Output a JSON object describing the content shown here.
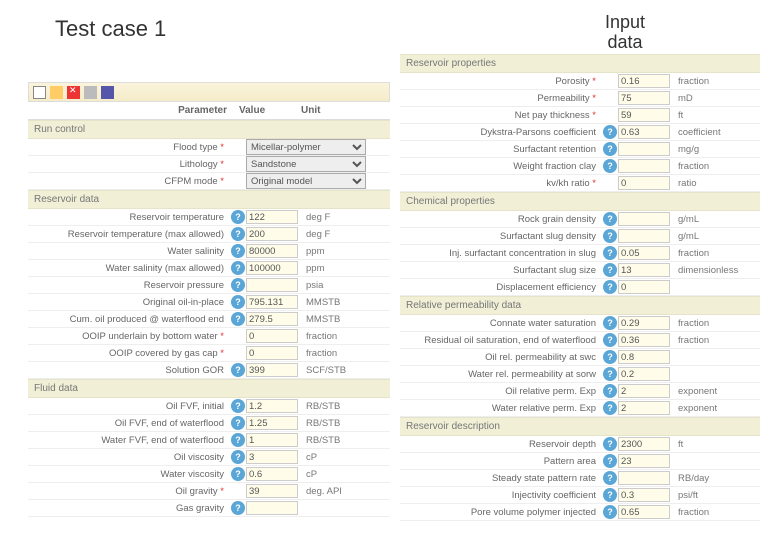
{
  "titles": {
    "left": "Test case 1",
    "right_l1": "Input",
    "right_l2": "data"
  },
  "columns": {
    "parameter": "Parameter",
    "value": "Value",
    "unit": "Unit"
  },
  "toolbar": {
    "new": "new-icon",
    "open": "open-icon",
    "delete": "delete-icon",
    "save": "save-icon"
  },
  "sections_left": [
    {
      "title": "Run control",
      "rows": [
        {
          "label": "Flood type",
          "req": true,
          "help": false,
          "value_select": "Micellar-polymer",
          "unit": ""
        },
        {
          "label": "Lithology",
          "req": true,
          "help": false,
          "value_select": "Sandstone",
          "unit": ""
        },
        {
          "label": "CFPM mode",
          "req": true,
          "help": false,
          "value_select": "Original model",
          "unit": ""
        }
      ]
    },
    {
      "title": "Reservoir data",
      "rows": [
        {
          "label": "Reservoir temperature",
          "req": false,
          "help": true,
          "value": "122",
          "unit": "deg F"
        },
        {
          "label": "Reservoir temperature (max allowed)",
          "req": false,
          "help": true,
          "value": "200",
          "unit": "deg F"
        },
        {
          "label": "Water salinity",
          "req": false,
          "help": true,
          "value": "80000",
          "unit": "ppm"
        },
        {
          "label": "Water salinity (max allowed)",
          "req": false,
          "help": true,
          "value": "100000",
          "unit": "ppm"
        },
        {
          "label": "Reservoir pressure",
          "req": false,
          "help": true,
          "value": "",
          "unit": "psia"
        },
        {
          "label": "Original oil-in-place",
          "req": false,
          "help": true,
          "value": "795.131",
          "unit": "MMSTB"
        },
        {
          "label": "Cum. oil produced @ waterflood end",
          "req": false,
          "help": true,
          "value": "279.5",
          "unit": "MMSTB"
        },
        {
          "label": "OOIP underlain by bottom water",
          "req": true,
          "help": false,
          "value": "0",
          "unit": "fraction"
        },
        {
          "label": "OOIP covered by gas cap",
          "req": true,
          "help": false,
          "value": "0",
          "unit": "fraction"
        },
        {
          "label": "Solution GOR",
          "req": false,
          "help": true,
          "value": "399",
          "unit": "SCF/STB"
        }
      ]
    },
    {
      "title": "Fluid data",
      "rows": [
        {
          "label": "Oil FVF, initial",
          "req": false,
          "help": true,
          "value": "1.2",
          "unit": "RB/STB"
        },
        {
          "label": "Oil FVF, end of waterflood",
          "req": false,
          "help": true,
          "value": "1.25",
          "unit": "RB/STB"
        },
        {
          "label": "Water FVF, end of waterflood",
          "req": false,
          "help": true,
          "value": "1",
          "unit": "RB/STB"
        },
        {
          "label": "Oil viscosity",
          "req": false,
          "help": true,
          "value": "3",
          "unit": "cP"
        },
        {
          "label": "Water viscosity",
          "req": false,
          "help": true,
          "value": "0.6",
          "unit": "cP"
        },
        {
          "label": "Oil gravity",
          "req": true,
          "help": false,
          "value": "39",
          "unit": "deg. API"
        },
        {
          "label": "Gas gravity",
          "req": false,
          "help": true,
          "value": "",
          "unit": ""
        }
      ]
    }
  ],
  "sections_right": [
    {
      "title": "Reservoir properties",
      "rows": [
        {
          "label": "Porosity",
          "req": true,
          "help": false,
          "value": "0.16",
          "unit": "fraction"
        },
        {
          "label": "Permeability",
          "req": true,
          "help": false,
          "value": "75",
          "unit": "mD"
        },
        {
          "label": "Net pay thickness",
          "req": true,
          "help": false,
          "value": "59",
          "unit": "ft"
        },
        {
          "label": "Dykstra-Parsons coefficient",
          "req": false,
          "help": true,
          "value": "0.63",
          "unit": "coefficient"
        },
        {
          "label": "Surfactant retention",
          "req": false,
          "help": true,
          "value": "",
          "unit": "mg/g"
        },
        {
          "label": "Weight fraction clay",
          "req": false,
          "help": true,
          "value": "",
          "unit": "fraction"
        },
        {
          "label": "kv/kh ratio",
          "req": true,
          "help": false,
          "value": "0",
          "unit": "ratio"
        }
      ]
    },
    {
      "title": "Chemical properties",
      "rows": [
        {
          "label": "Rock grain density",
          "req": false,
          "help": true,
          "value": "",
          "unit": "g/mL"
        },
        {
          "label": "Surfactant slug density",
          "req": false,
          "help": true,
          "value": "",
          "unit": "g/mL"
        },
        {
          "label": "Inj. surfactant concentration in slug",
          "req": false,
          "help": true,
          "value": "0.05",
          "unit": "fraction"
        },
        {
          "label": "Surfactant slug size",
          "req": false,
          "help": true,
          "value": "13",
          "unit": "dimensionless"
        },
        {
          "label": "Displacement efficiency",
          "req": false,
          "help": true,
          "value": "0",
          "unit": ""
        }
      ]
    },
    {
      "title": "Relative permeability data",
      "rows": [
        {
          "label": "Connate water saturation",
          "req": false,
          "help": true,
          "value": "0.29",
          "unit": "fraction"
        },
        {
          "label": "Residual oil saturation, end of waterflood",
          "req": false,
          "help": true,
          "value": "0.36",
          "unit": "fraction"
        },
        {
          "label": "Oil rel. permeability at swc",
          "req": false,
          "help": true,
          "value": "0.8",
          "unit": ""
        },
        {
          "label": "Water rel. permeability at sorw",
          "req": false,
          "help": true,
          "value": "0.2",
          "unit": ""
        },
        {
          "label": "Oil relative perm. Exp",
          "req": false,
          "help": true,
          "value": "2",
          "unit": "exponent"
        },
        {
          "label": "Water relative perm. Exp",
          "req": false,
          "help": true,
          "value": "2",
          "unit": "exponent"
        }
      ]
    },
    {
      "title": "Reservoir description",
      "rows": [
        {
          "label": "Reservoir depth",
          "req": false,
          "help": true,
          "value": "2300",
          "unit": "ft"
        },
        {
          "label": "Pattern area",
          "req": false,
          "help": true,
          "value": "23",
          "unit": ""
        },
        {
          "label": "Steady state pattern rate",
          "req": false,
          "help": true,
          "value": "",
          "unit": "RB/day"
        },
        {
          "label": "Injectivity coefficient",
          "req": false,
          "help": true,
          "value": "0.3",
          "unit": "psi/ft"
        },
        {
          "label": "Pore volume polymer injected",
          "req": false,
          "help": true,
          "value": "0.65",
          "unit": "fraction"
        }
      ]
    }
  ]
}
